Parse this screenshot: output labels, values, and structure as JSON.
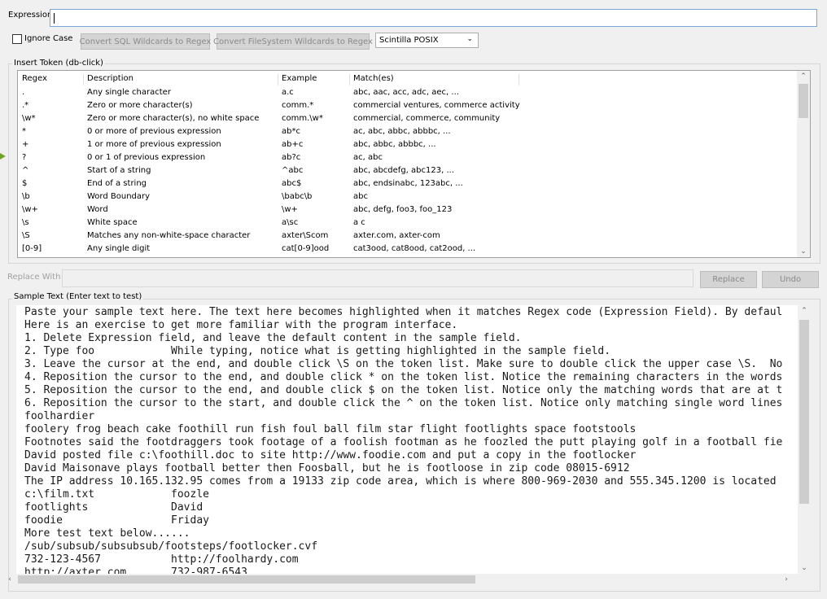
{
  "expression": {
    "label": "Expression",
    "value": ""
  },
  "options": {
    "ignore_case_label": "Ignore Case",
    "sql_button": "Convert SQL Wildcards to Regex",
    "fs_button": "Convert FileSystem Wildcards to Regex",
    "engine_selected": "Scintilla POSIX"
  },
  "tokens": {
    "label": "Insert Token (db-click)",
    "columns": [
      "Regex",
      "Description",
      "Example",
      "Match(es)"
    ],
    "rows": [
      [
        ".",
        "Any single character",
        "a.c",
        "abc, aac, acc, adc, aec, ..."
      ],
      [
        ".*",
        "Zero or more character(s)",
        "comm.*",
        "commercial ventures, commerce activity"
      ],
      [
        "\\w*",
        "Zero or more character(s), no white space",
        "comm.\\w*",
        "commercial, commerce, community"
      ],
      [
        "*",
        "0 or more of previous expression",
        "ab*c",
        "ac, abc, abbc, abbbc, ..."
      ],
      [
        "+",
        "1 or more of previous expression",
        "ab+c",
        "abc, abbc, abbbc, ..."
      ],
      [
        "?",
        "0 or 1 of previous expression",
        "ab?c",
        "ac, abc"
      ],
      [
        "^",
        "Start of a string",
        "^abc",
        "abc, abcdefg, abc123, ..."
      ],
      [
        "$",
        "End of a string",
        "abc$",
        "abc, endsinabc, 123abc, ..."
      ],
      [
        "\\b",
        "Word Boundary",
        "\\babc\\b",
        "abc"
      ],
      [
        "\\w+",
        "Word",
        "\\w+",
        "abc, defg, foo3, foo_123"
      ],
      [
        "\\s",
        "White space",
        "a\\sc",
        "a c"
      ],
      [
        "\\S",
        "Matches any non-white-space character",
        "axter\\Scom",
        "axter.com, axter-com"
      ],
      [
        "[0-9]",
        "Any single digit",
        "cat[0-9]ood",
        "cat3ood, cat8ood, cat2ood, ..."
      ]
    ]
  },
  "replace": {
    "label": "Replace With",
    "value": "",
    "replace_button": "Replace",
    "undo_button": "Undo"
  },
  "sample": {
    "label": "Sample Text (Enter text to test)",
    "lines": [
      "Paste your sample text here. The text here becomes highlighted when it matches Regex code (Expression Field). By defaul",
      "Here is an exercise to get more familiar with the program interface.",
      "1. Delete Expression field, and leave the default content in the sample field.",
      "2. Type foo            While typing, notice what is getting highlighted in the sample field.",
      "3. Leave the cursor at the end, and double click \\S on the token list. Make sure to double click the upper case \\S.  No",
      "4. Reposition the cursor to the end, and double click * on the token list. Notice the remaining characters in the words",
      "5. Reposition the cursor to the end, and double click $ on the token list. Notice only the matching words that are at t",
      "6. Reposition the cursor to the start, and double click the ^ on the token list. Notice only matching single word lines",
      "foolhardier",
      "foolery frog beach cake foothill run fish foul ball film star flight footlights space footstools",
      "Footnotes said the footdraggers took footage of a foolish footman as he foozled the putt playing golf in a football fie",
      "David posted file c:\\foothill.doc to site http://www.foodie.com and put a copy in the footlocker",
      "David Maisonave plays football better then Foosball, but he is footloose in zip code 08015-6912",
      "The IP address 10.165.132.95 comes from a 19133 zip code area, which is where 800-969-2030 and 555.345.1200 is located",
      "c:\\film.txt            foozle",
      "footlights             David",
      "foodie                 Friday",
      "More test text below......",
      "/sub/subsub/subsubsub/footsteps/footlocker.cvf",
      "732-123-4567           http://foolhardy.com",
      "http://axter.com       732-987-6543"
    ]
  }
}
